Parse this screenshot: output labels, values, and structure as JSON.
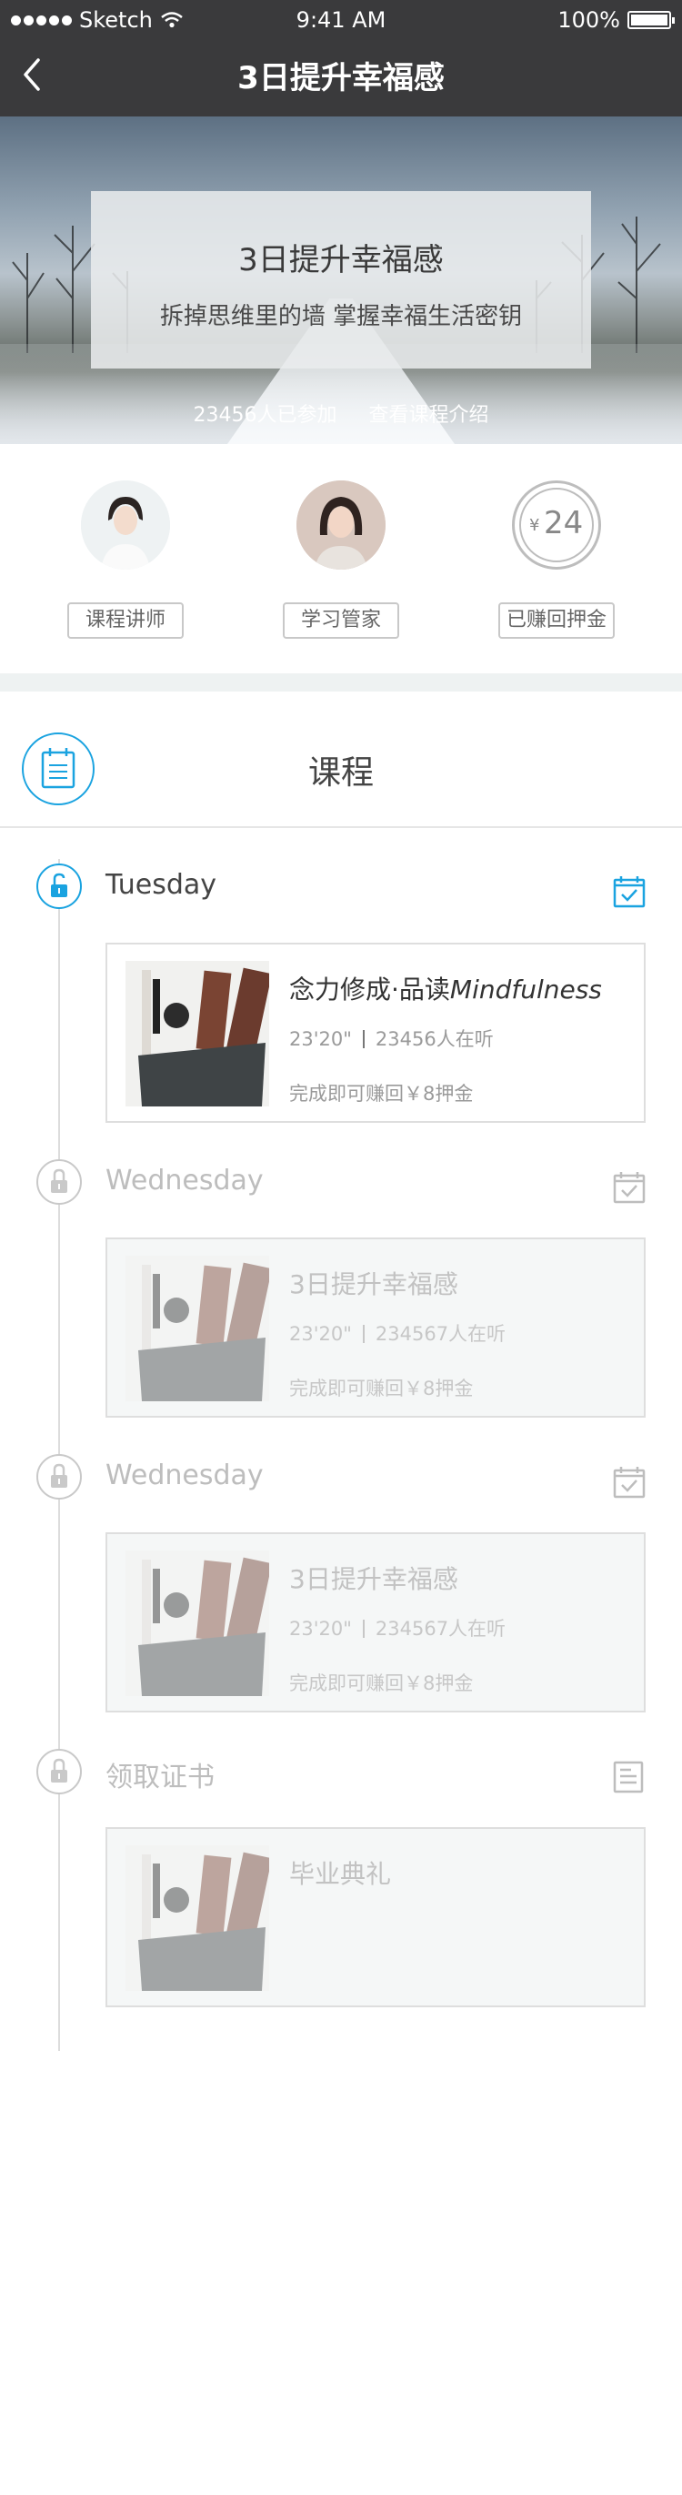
{
  "status": {
    "carrier": "Sketch",
    "time": "9:41 AM",
    "battery": "100%"
  },
  "nav": {
    "title": "3日提升幸福感"
  },
  "hero": {
    "title": "3日提升幸福感",
    "subtitle": "拆掉思维里的墙 掌握幸福生活密钥",
    "participants": "23456人已参加",
    "intro_link": "查看课程介绍"
  },
  "roles": {
    "lecturer": "课程讲师",
    "manager": "学习管家",
    "deposit_symbol": "¥",
    "deposit_amount": "24",
    "deposit_label": "已赚回押金"
  },
  "course": {
    "header": "课程"
  },
  "days": [
    {
      "title": "Tuesday",
      "card": {
        "name": "念力修成·品读",
        "name_em": "Mindfulness",
        "duration": "23'20\"",
        "listeners": "23456人在听",
        "reward": "完成即可赚回￥8押金"
      }
    },
    {
      "title": "Wednesday",
      "card": {
        "name": "3日提升幸福感",
        "duration": "23'20\"",
        "listeners": "234567人在听",
        "reward": "完成即可赚回￥8押金"
      }
    },
    {
      "title": "Wednesday",
      "card": {
        "name": "3日提升幸福感",
        "duration": "23'20\"",
        "listeners": "234567人在听",
        "reward": "完成即可赚回￥8押金"
      }
    },
    {
      "title": "领取证书",
      "card": {
        "name": "毕业典礼"
      }
    }
  ],
  "colors": {
    "accent": "#1aa3e0",
    "navbar": "#3a3a3c",
    "muted": "#bdbdbd"
  }
}
